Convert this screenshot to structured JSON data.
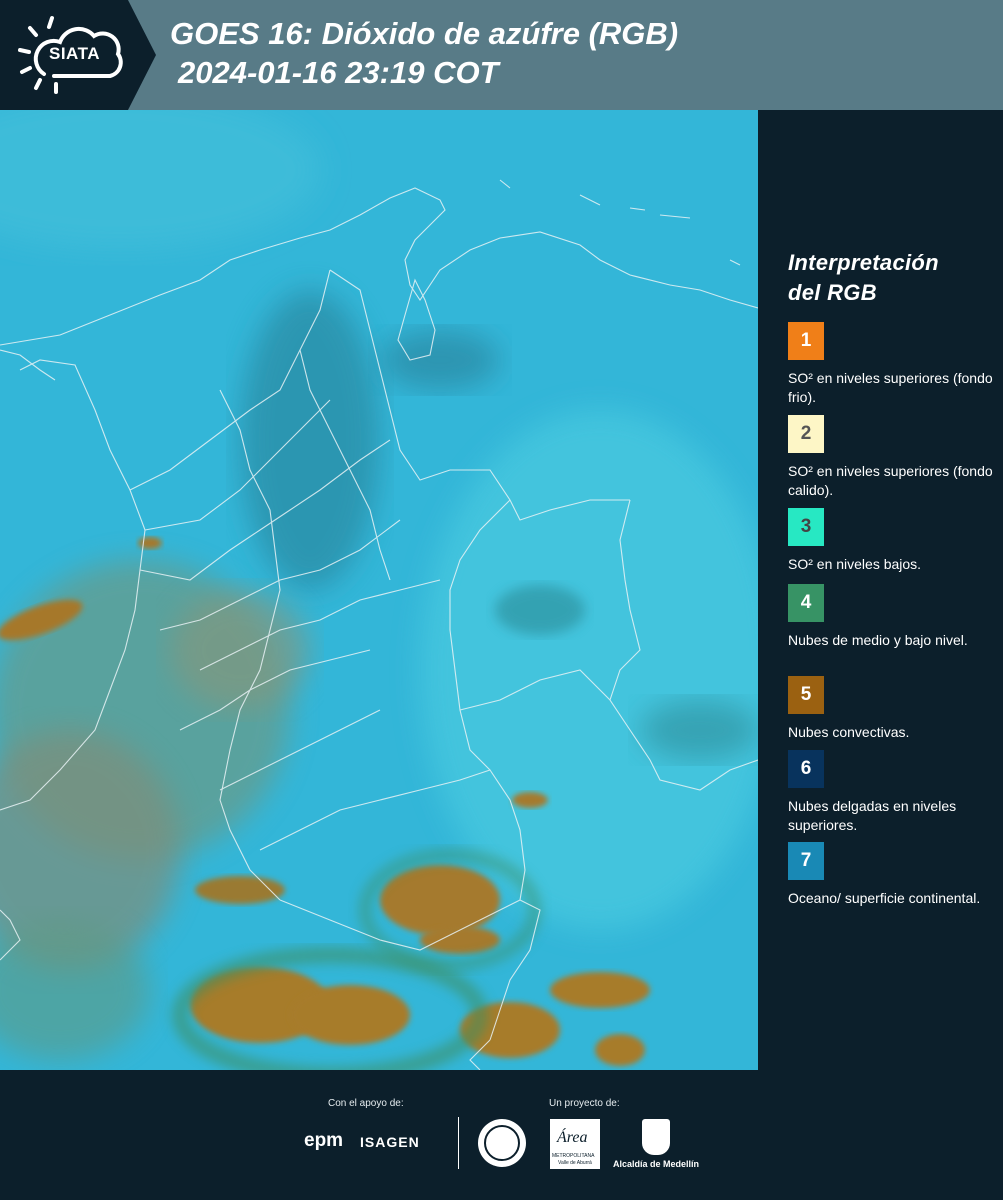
{
  "header": {
    "logo_text": "SIATA",
    "title_line1": "GOES 16: Dióxido de azúfre (RGB)",
    "title_line2": "2024-01-16 23:19 COT"
  },
  "map": {
    "ocean_color": "#33b6d8"
  },
  "legend": {
    "title_line1": "Interpretación",
    "title_line2": "del RGB",
    "items": [
      {
        "num": "1",
        "color": "#f07f18",
        "text_color": "#ffffff",
        "label": "SO² en niveles superiores (fondo frio)."
      },
      {
        "num": "2",
        "color": "#fdf6c6",
        "text_color": "#555555",
        "label": "SO² en niveles superiores (fondo calido)."
      },
      {
        "num": "3",
        "color": "#27e8c3",
        "text_color": "#444444",
        "label": "SO² en niveles bajos."
      },
      {
        "num": "4",
        "color": "#379365",
        "text_color": "#ffffff",
        "label": "Nubes de medio y bajo nivel."
      },
      {
        "num": "5",
        "color": "#9b6111",
        "text_color": "#ffffff",
        "label": "Nubes convectivas."
      },
      {
        "num": "6",
        "color": "#08335d",
        "text_color": "#ffffff",
        "label": "Nubes delgadas en niveles superiores."
      },
      {
        "num": "7",
        "color": "#1989b5",
        "text_color": "#ffffff",
        "label": "Oceano/ superficie continental."
      }
    ]
  },
  "footer": {
    "support_label": "Con el apoyo de:",
    "project_label": "Un proyecto de:",
    "sponsor1": "epm",
    "sponsor2": "ISAGEN",
    "partner_area": "Área",
    "partner_area_sub": "METROPOLITANA",
    "partner_area_sub2": "Valle de Aburrá",
    "partner_alcaldia": "Alcaldía de Medellín"
  }
}
